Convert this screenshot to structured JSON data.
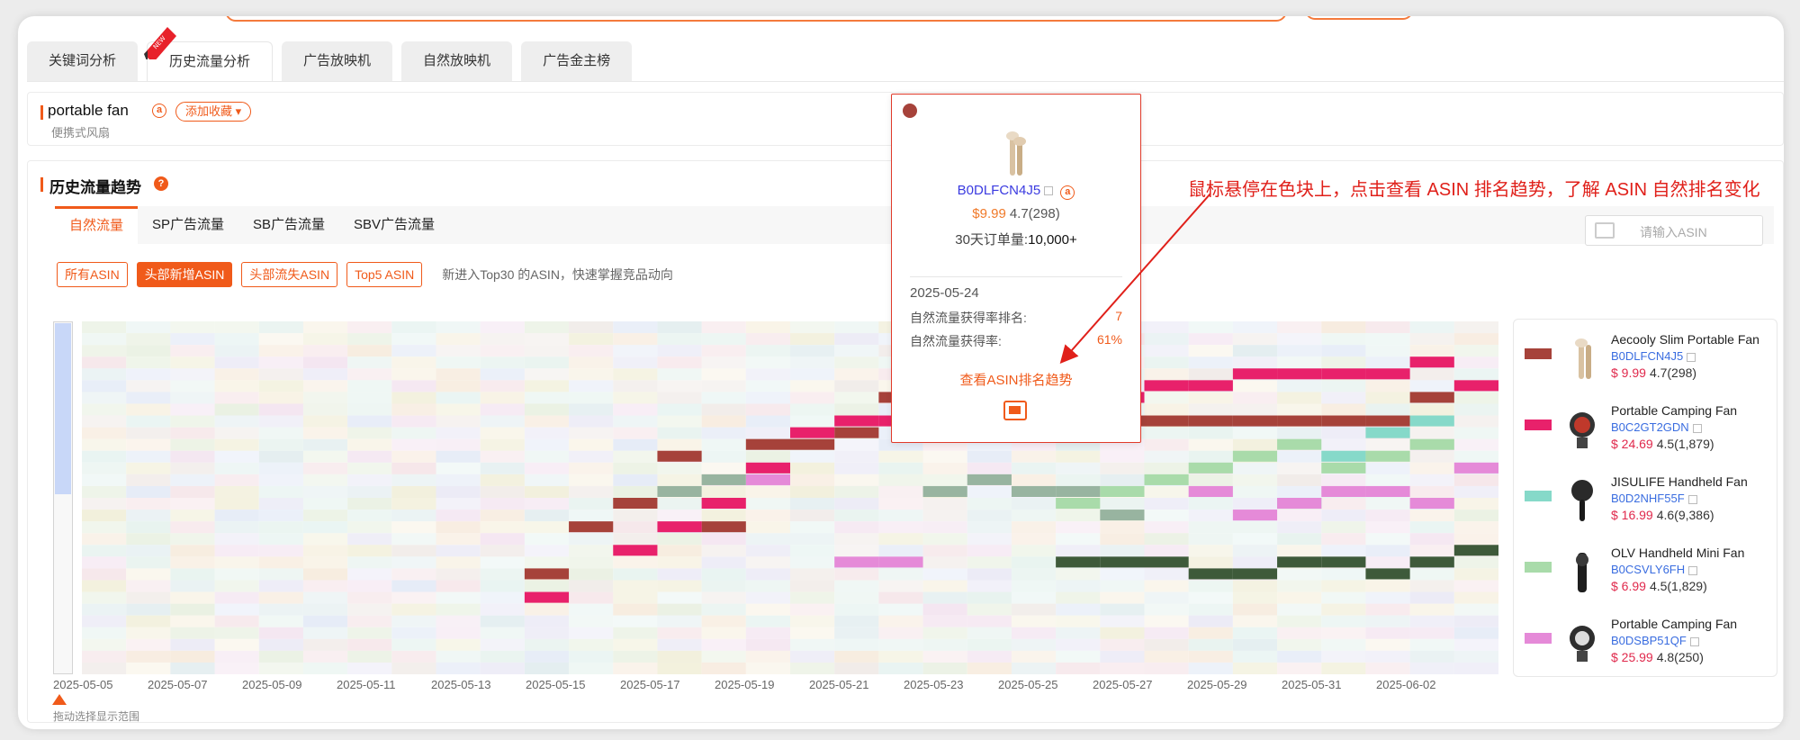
{
  "tabs": [
    {
      "label": "关键词分析",
      "active": false
    },
    {
      "label": "历史流量分析",
      "active": true
    },
    {
      "label": "广告放映机",
      "active": false
    },
    {
      "label": "自然放映机",
      "active": false
    },
    {
      "label": "广告金主榜",
      "active": false
    }
  ],
  "new_badge": "NEW",
  "keyword": {
    "title": "portable fan",
    "amazon_badge": "a",
    "favorite_label": "添加收藏 ▾",
    "translation": "便携式风扇"
  },
  "history": {
    "title": "历史流量趋势",
    "help": "?",
    "subtabs": [
      "自然流量",
      "SP广告流量",
      "SB广告流量",
      "SBV广告流量"
    ],
    "active_subtab": 0,
    "asin_search_placeholder": "请输入ASIN",
    "filters": [
      "所有ASIN",
      "头部新增ASIN",
      "头部流失ASIN",
      "Top5 ASIN"
    ],
    "active_filter": 1,
    "filter_note": "新进入Top30 的ASIN，快速掌握竞品动向",
    "range_note": "拖动选择显示范围",
    "dates": [
      "2025-05-05",
      "2025-05-07",
      "2025-05-09",
      "2025-05-11",
      "2025-05-13",
      "2025-05-15",
      "2025-05-17",
      "2025-05-19",
      "2025-05-21",
      "2025-05-23",
      "2025-05-25",
      "2025-05-27",
      "2025-05-29",
      "2025-05-31",
      "2025-06-02"
    ]
  },
  "legend": [
    {
      "name": "Aecooly Slim Portable Fan",
      "asin": "B0DLFCN4J5",
      "price": "$ 9.99",
      "rating": "4.7(298)",
      "color": "#a6423a",
      "icon": "handheld-fan-beige"
    },
    {
      "name": "Portable Camping Fan",
      "asin": "B0C2GT2GDN",
      "price": "$ 24.69",
      "rating": "4.5(1,879)",
      "color": "#e8216b",
      "icon": "camping-fan"
    },
    {
      "name": "JISULIFE Handheld Fan",
      "asin": "B0D2NHF55F",
      "price": "$ 16.99",
      "rating": "4.6(9,386)",
      "color": "#86d9c9",
      "icon": "handheld-fan-black"
    },
    {
      "name": "OLV Handheld Mini Fan",
      "asin": "B0CSVLY6FH",
      "price": "$ 6.99",
      "rating": "4.5(1,829)",
      "color": "#a9dbaa",
      "icon": "mini-fan-black"
    },
    {
      "name": "Portable Camping Fan",
      "asin": "B0DSBP51QF",
      "price": "$ 25.99",
      "rating": "4.8(250)",
      "color": "#e58ad8",
      "icon": "camping-fan-light"
    }
  ],
  "tooltip": {
    "asin": "B0DLFCN4J5",
    "amazon_badge": "a",
    "price": "$9.99",
    "rating": "4.7(298)",
    "orders_label": "30天订单量:",
    "orders_value": "10,000+",
    "date": "2025-05-24",
    "rank_label": "自然流量获得率排名:",
    "rank_value": "7",
    "rate_label": "自然流量获得率:",
    "rate_value": "61%",
    "link": "查看ASIN排名趋势",
    "dot_color": "#a6423a"
  },
  "annotation": "鼠标悬停在色块上，点击查看 ASIN 排名趋势，了解 ASIN 自然排名变化",
  "heatmap_data": {
    "highlight_series": [
      {
        "color": "#a6423a",
        "cells": [
          [
            10,
            21
          ],
          [
            11,
            17
          ],
          [
            12,
            15
          ],
          [
            13,
            11
          ],
          [
            14,
            17
          ],
          [
            15,
            10
          ],
          [
            16,
            10
          ],
          [
            17,
            9
          ],
          [
            18,
            6
          ],
          [
            19,
            6
          ],
          [
            20,
            6
          ],
          [
            21,
            8
          ],
          [
            22,
            8
          ],
          [
            23,
            8
          ],
          [
            24,
            8
          ],
          [
            25,
            8
          ],
          [
            26,
            8
          ],
          [
            27,
            8
          ],
          [
            28,
            8
          ],
          [
            29,
            8
          ],
          [
            30,
            6
          ]
        ]
      },
      {
        "color": "#e8216b",
        "cells": [
          [
            10,
            23
          ],
          [
            12,
            19
          ],
          [
            13,
            17
          ],
          [
            14,
            15
          ],
          [
            15,
            12
          ],
          [
            16,
            9
          ],
          [
            17,
            8
          ],
          [
            18,
            8
          ],
          [
            19,
            6
          ],
          [
            20,
            5
          ],
          [
            21,
            5
          ],
          [
            22,
            6
          ],
          [
            23,
            6
          ],
          [
            24,
            5
          ],
          [
            25,
            5
          ],
          [
            26,
            4
          ],
          [
            27,
            4
          ],
          [
            28,
            4
          ],
          [
            29,
            4
          ],
          [
            30,
            3
          ],
          [
            31,
            5
          ]
        ]
      },
      {
        "color": "#86d9c9",
        "cells": [
          [
            27,
            15
          ],
          [
            28,
            11
          ],
          [
            29,
            9
          ],
          [
            30,
            8
          ]
        ]
      },
      {
        "color": "#a9dbaa",
        "cells": [
          [
            22,
            15
          ],
          [
            23,
            14
          ],
          [
            24,
            13
          ],
          [
            25,
            12
          ],
          [
            26,
            11
          ],
          [
            27,
            10
          ],
          [
            28,
            12
          ],
          [
            29,
            11
          ],
          [
            30,
            10
          ]
        ]
      },
      {
        "color": "#e58ad8",
        "cells": [
          [
            15,
            13
          ],
          [
            17,
            20
          ],
          [
            18,
            20
          ],
          [
            25,
            14
          ],
          [
            26,
            16
          ],
          [
            27,
            15
          ],
          [
            28,
            14
          ],
          [
            29,
            14
          ],
          [
            30,
            15
          ],
          [
            31,
            12
          ]
        ]
      },
      {
        "color": "#98b4a0",
        "cells": [
          [
            13,
            14
          ],
          [
            14,
            13
          ],
          [
            19,
            14
          ],
          [
            20,
            13
          ],
          [
            21,
            14
          ],
          [
            22,
            14
          ],
          [
            23,
            16
          ]
        ]
      },
      {
        "color": "#3e5a3a",
        "cells": [
          [
            22,
            20
          ],
          [
            23,
            20
          ],
          [
            24,
            20
          ],
          [
            25,
            21
          ],
          [
            26,
            21
          ],
          [
            27,
            20
          ],
          [
            28,
            20
          ],
          [
            29,
            21
          ],
          [
            30,
            20
          ],
          [
            31,
            19
          ]
        ]
      }
    ]
  }
}
